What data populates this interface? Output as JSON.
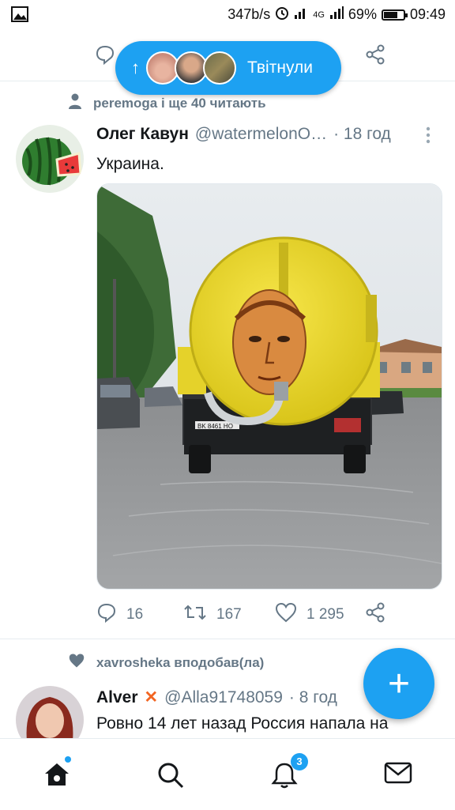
{
  "status_bar": {
    "speed": "347b/s",
    "network": "4G",
    "battery": "69%",
    "battery_level": 0.69,
    "time": "09:49"
  },
  "pill": {
    "arrow": "↑",
    "label": "Твітнули"
  },
  "tweet1": {
    "context": "peremoga і ще 40 читають",
    "name": "Олег Кавун",
    "handle": "@watermelonO…",
    "time": "· 18 год",
    "text": "Украина.",
    "plate": "BK 8461 HO",
    "replies": "16",
    "retweets": "167",
    "likes": "1 295"
  },
  "tweet2": {
    "context": "xavrosheka вподобав(ла)",
    "name": "Alver",
    "badge": "✕",
    "handle": "@Alla91748059",
    "time": "· 8 год",
    "text": "Ровно 14 лет назад Россия напала на"
  },
  "fab": {
    "label": "+"
  },
  "nav": {
    "notifications_badge": "3"
  },
  "colors": {
    "accent": "#1da1f2",
    "muted": "#657786",
    "text": "#14171a"
  }
}
